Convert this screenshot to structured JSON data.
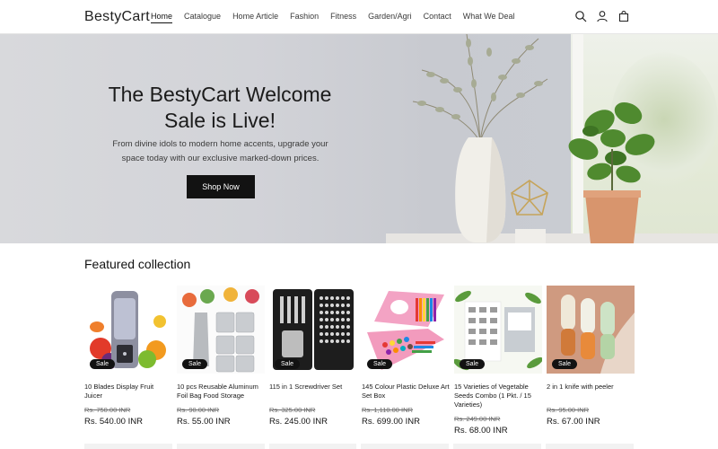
{
  "header": {
    "logo": "BestyCart",
    "nav": [
      "Home",
      "Catalogue",
      "Home Article",
      "Fashion",
      "Fitness",
      "Garden/Agri",
      "Contact",
      "What We Deal"
    ],
    "active_nav": "Home",
    "icons": [
      "search-icon",
      "account-icon",
      "cart-icon"
    ]
  },
  "hero": {
    "title_line1": "The BestyCart Welcome",
    "title_line2": "Sale is Live!",
    "subtitle_line1": "From divine idols to modern home accents, upgrade your",
    "subtitle_line2": "space today with our exclusive marked-down prices.",
    "button": "Shop Now"
  },
  "featured": {
    "title": "Featured collection",
    "badge": "Sale",
    "products": [
      {
        "title": "10 Blades Display Fruit Juicer",
        "old_price": "Rs. 750.00 INR",
        "price": "Rs. 540.00 INR"
      },
      {
        "title": "10 pcs Reusable Aluminum Foil Bag Food Storage",
        "old_price": "Rs. 90.00 INR",
        "price": "Rs. 55.00 INR"
      },
      {
        "title": "115 in 1 Screwdriver Set",
        "old_price": "Rs. 325.00 INR",
        "price": "Rs. 245.00 INR"
      },
      {
        "title": "145 Colour Plastic Deluxe Art Set Box",
        "old_price": "Rs. 1,110.00 INR",
        "price": "Rs. 699.00 INR"
      },
      {
        "title": "15 Varieties of Vegetable Seeds Combo (1 Pkt. / 15 Varieties)",
        "old_price": "Rs. 249.00 INR",
        "price": "Rs. 68.00 INR"
      },
      {
        "title": "2 in 1 knife with peeler",
        "old_price": "Rs. 95.00 INR",
        "price": "Rs. 67.00 INR"
      }
    ]
  },
  "colors": {
    "accent": "#121212",
    "hero_bg": "#d2d3d8",
    "badge": "#121212"
  }
}
